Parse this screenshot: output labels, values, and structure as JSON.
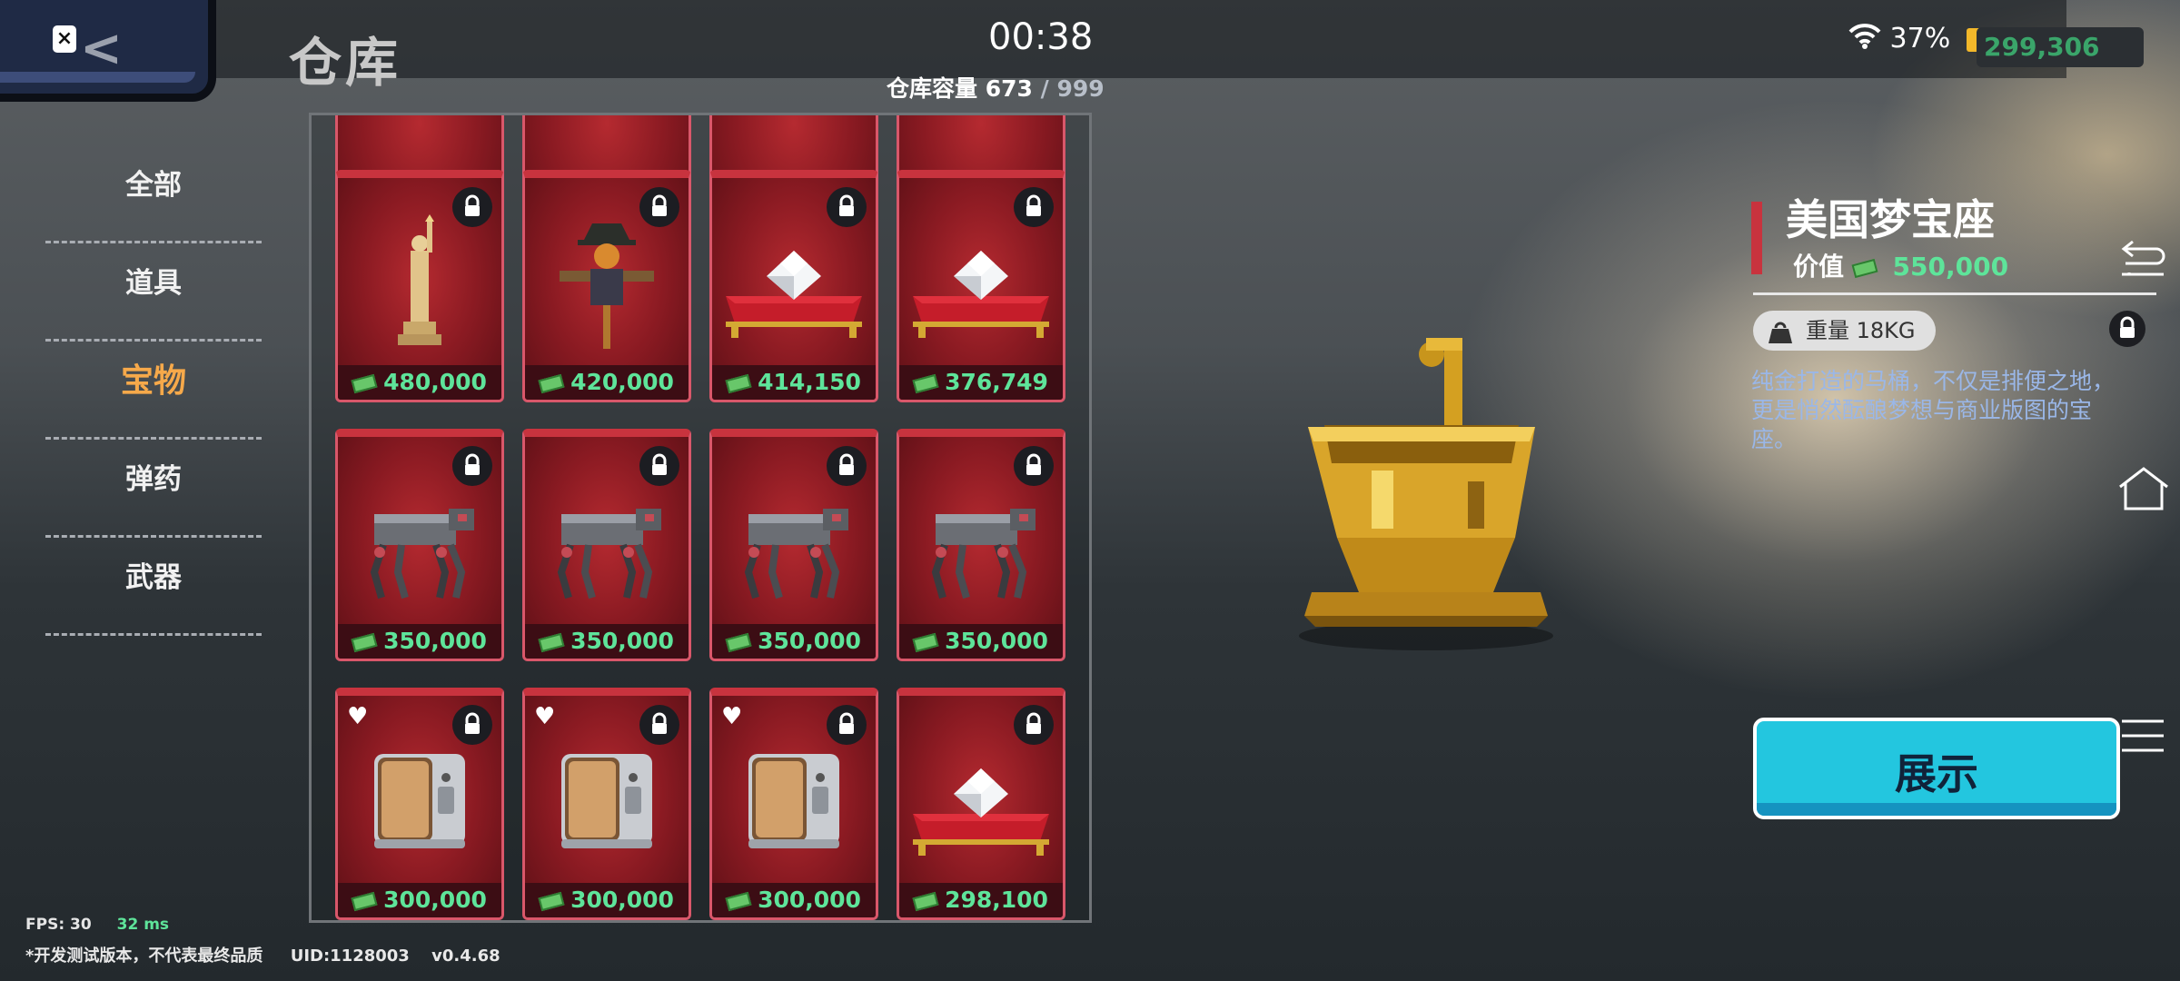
{
  "header": {
    "title": "仓库",
    "clock": "00:38",
    "capacity_label": "仓库容量",
    "capacity_used": "673",
    "capacity_max": "/ 999",
    "battery": "37%",
    "money": "299,306"
  },
  "sidebar": {
    "items": [
      {
        "label": "全部"
      },
      {
        "label": "道具"
      },
      {
        "label": "宝物"
      },
      {
        "label": "弹药"
      },
      {
        "label": "武器"
      }
    ]
  },
  "grid": {
    "items": [
      {
        "price": "480,000",
        "art": "statue-icon"
      },
      {
        "price": "420,000",
        "art": "scarecrow-icon"
      },
      {
        "price": "414,150",
        "art": "diamond-cushion-icon"
      },
      {
        "price": "376,749",
        "art": "diamond-cushion-icon"
      },
      {
        "price": "350,000",
        "art": "robot-dog-icon"
      },
      {
        "price": "350,000",
        "art": "robot-dog-icon"
      },
      {
        "price": "350,000",
        "art": "robot-dog-icon"
      },
      {
        "price": "350,000",
        "art": "robot-dog-icon"
      },
      {
        "price": "300,000",
        "art": "safe-icon",
        "favorite": true
      },
      {
        "price": "300,000",
        "art": "safe-icon",
        "favorite": true
      },
      {
        "price": "300,000",
        "art": "safe-icon",
        "favorite": true
      },
      {
        "price": "298,100",
        "art": "diamond-cushion-icon"
      }
    ]
  },
  "detail": {
    "name": "美国梦宝座",
    "value_label": "价值",
    "value": "550,000",
    "weight_label": "重量",
    "weight": "18KG",
    "description": "纯金打造的马桶，不仅是排便之地，更是悄然酝酿梦想与商业版图的宝座。",
    "show_button": "展示"
  },
  "footer": {
    "fps": "FPS: 30",
    "ping": "32 ms",
    "notice": "*开发测试版本，不代表最终品质",
    "uid": "UID:1128003",
    "version": "v0.4.68"
  },
  "colors": {
    "accent_cyan": "#23c6df",
    "price_green": "#5ee49a",
    "card_red": "#8a1a22",
    "active_tab": "#f6a94a"
  }
}
